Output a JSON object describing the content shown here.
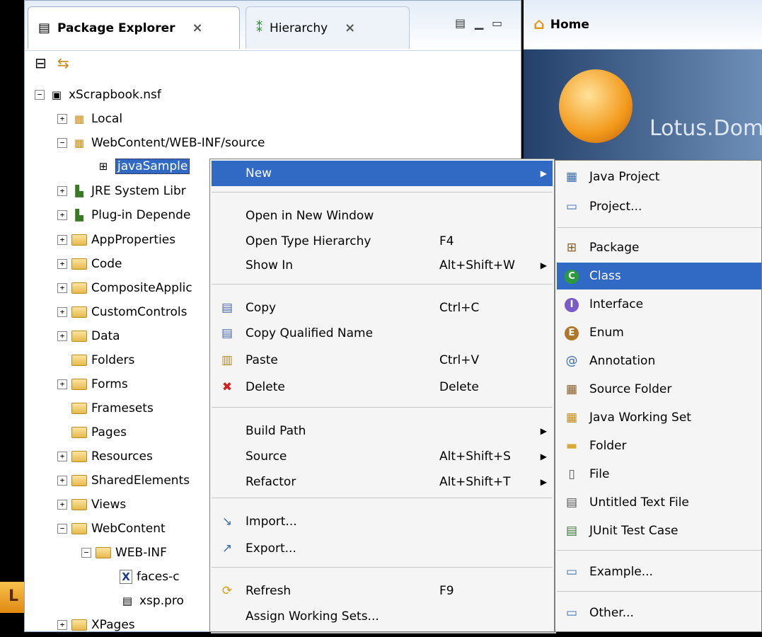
{
  "package_explorer": {
    "tab_label": "Package Explorer",
    "hierarchy_tab_label": "Hierarchy",
    "close_glyph": "×"
  },
  "home": {
    "tab_label": "Home",
    "brand": "Lotus.Dom"
  },
  "lotus_letter": "L",
  "tree": [
    {
      "label": "xScrapbook.nsf",
      "expander": "−",
      "icon": "project-icon"
    },
    {
      "label": "Local",
      "expander": "+",
      "icon": "package-folder-icon"
    },
    {
      "label": "WebContent/WEB-INF/source",
      "expander": "−",
      "icon": "package-folder-icon"
    },
    {
      "label": "javaSample",
      "expander": "",
      "icon": "package-icon",
      "selected": true
    },
    {
      "label": "JRE System Libr",
      "expander": "+",
      "icon": "library-icon"
    },
    {
      "label": "Plug-in Depende",
      "expander": "+",
      "icon": "library-icon"
    },
    {
      "label": "AppProperties",
      "expander": "+",
      "icon": "folder-icon"
    },
    {
      "label": "Code",
      "expander": "+",
      "icon": "folder-icon"
    },
    {
      "label": "CompositeApplic",
      "expander": "+",
      "icon": "folder-icon"
    },
    {
      "label": "CustomControls",
      "expander": "+",
      "icon": "folder-icon"
    },
    {
      "label": "Data",
      "expander": "+",
      "icon": "folder-icon"
    },
    {
      "label": "Folders",
      "expander": "",
      "icon": "folder-icon"
    },
    {
      "label": "Forms",
      "expander": "+",
      "icon": "folder-icon"
    },
    {
      "label": "Framesets",
      "expander": "",
      "icon": "folder-icon"
    },
    {
      "label": "Pages",
      "expander": "",
      "icon": "folder-icon"
    },
    {
      "label": "Resources",
      "expander": "+",
      "icon": "folder-icon"
    },
    {
      "label": "SharedElements",
      "expander": "+",
      "icon": "folder-icon"
    },
    {
      "label": "Views",
      "expander": "+",
      "icon": "folder-icon"
    },
    {
      "label": "WebContent",
      "expander": "−",
      "icon": "folder-icon"
    },
    {
      "label": "WEB-INF",
      "expander": "−",
      "icon": "folder-icon"
    },
    {
      "label": "faces-c",
      "expander": "",
      "icon": "xml-file-icon"
    },
    {
      "label": "xsp.pro",
      "expander": "",
      "icon": "file-icon"
    },
    {
      "label": "XPages",
      "expander": "+",
      "icon": "folder-icon"
    }
  ],
  "context_menu": [
    {
      "label": "New",
      "shortcut": "",
      "submenu": true,
      "highlighted": true,
      "icon": ""
    },
    {
      "label": "Open in New Window",
      "shortcut": "",
      "icon": ""
    },
    {
      "label": "Open Type Hierarchy",
      "shortcut": "F4",
      "icon": ""
    },
    {
      "label": "Show In",
      "shortcut": "Alt+Shift+W",
      "submenu": true,
      "icon": ""
    },
    {
      "label": "Copy",
      "shortcut": "Ctrl+C",
      "icon": "copy-icon"
    },
    {
      "label": "Copy Qualified Name",
      "shortcut": "",
      "icon": "copy-qualified-name-icon"
    },
    {
      "label": "Paste",
      "shortcut": "Ctrl+V",
      "icon": "paste-icon"
    },
    {
      "label": "Delete",
      "shortcut": "Delete",
      "icon": "delete-icon"
    },
    {
      "label": "Build Path",
      "shortcut": "",
      "submenu": true,
      "icon": ""
    },
    {
      "label": "Source",
      "shortcut": "Alt+Shift+S",
      "submenu": true,
      "icon": ""
    },
    {
      "label": "Refactor",
      "shortcut": "Alt+Shift+T",
      "submenu": true,
      "icon": ""
    },
    {
      "label": "Import...",
      "shortcut": "",
      "icon": "import-icon"
    },
    {
      "label": "Export...",
      "shortcut": "",
      "icon": "export-icon"
    },
    {
      "label": "Refresh",
      "shortcut": "F9",
      "icon": "refresh-icon"
    },
    {
      "label": "Assign Working Sets...",
      "shortcut": "",
      "icon": ""
    }
  ],
  "new_submenu": [
    {
      "label": "Java Project",
      "icon": "java-project-icon"
    },
    {
      "label": "Project...",
      "icon": "project-wizard-icon"
    },
    {
      "label": "Package",
      "icon": "package-icon"
    },
    {
      "label": "Class",
      "icon": "class-icon",
      "highlighted": true
    },
    {
      "label": "Interface",
      "icon": "interface-icon"
    },
    {
      "label": "Enum",
      "icon": "enum-icon"
    },
    {
      "label": "Annotation",
      "icon": "annotation-icon"
    },
    {
      "label": "Source Folder",
      "icon": "source-folder-icon"
    },
    {
      "label": "Java Working Set",
      "icon": "working-set-icon"
    },
    {
      "label": "Folder",
      "icon": "folder-icon"
    },
    {
      "label": "File",
      "icon": "file-icon"
    },
    {
      "label": "Untitled Text File",
      "icon": "text-file-icon"
    },
    {
      "label": "JUnit Test Case",
      "icon": "junit-icon"
    },
    {
      "label": "Example...",
      "icon": "example-icon"
    },
    {
      "label": "Other...",
      "icon": "other-wizard-icon"
    }
  ]
}
